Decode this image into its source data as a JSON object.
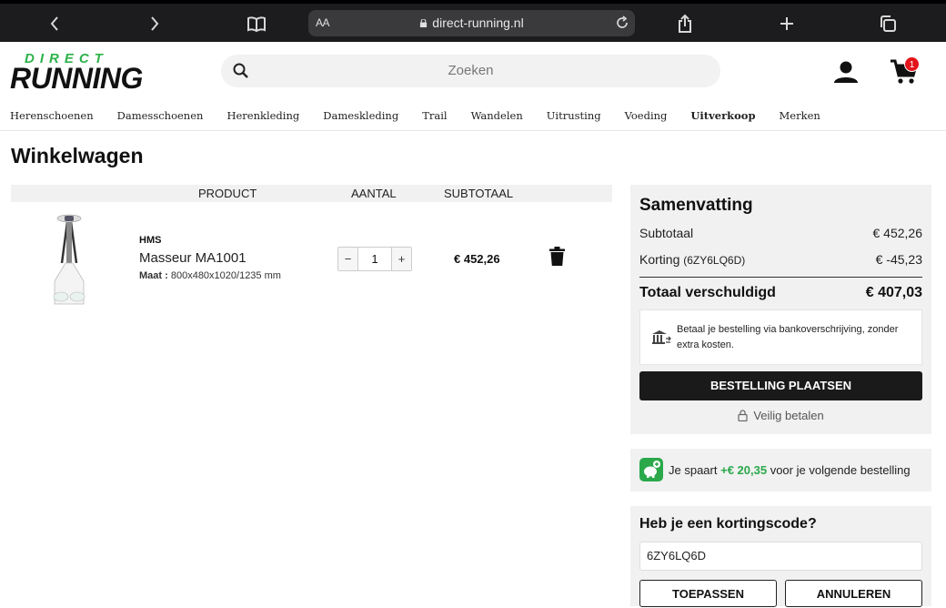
{
  "browser": {
    "aa": "AA",
    "url": "direct-running.nl"
  },
  "logo": {
    "top": "DIRECT",
    "bottom": "RUNNING"
  },
  "search": {
    "placeholder": "Zoeken"
  },
  "cart": {
    "count": "1"
  },
  "nav": [
    "Herenschoenen",
    "Damesschoenen",
    "Herenkleding",
    "Dameskleding",
    "Trail",
    "Wandelen",
    "Uitrusting",
    "Voeding",
    "Uitverkoop",
    "Merken"
  ],
  "page": {
    "title": "Winkelwagen"
  },
  "table": {
    "headers": {
      "product": "PRODUCT",
      "qty": "AANTAL",
      "subtotal": "SUBTOTAAL"
    },
    "item": {
      "brand": "HMS",
      "name": "Masseur MA1001",
      "size_label": "Maat :",
      "size_value": "800x480x1020/1235 mm",
      "qty_minus": "−",
      "qty": "1",
      "qty_plus": "+",
      "total": "€ 452,26"
    }
  },
  "summary": {
    "title": "Samenvatting",
    "subtotal_label": "Subtotaal",
    "subtotal_value": "€ 452,26",
    "discount_label": "Korting",
    "discount_code": "(6ZY6LQ6D)",
    "discount_value": "€ -45,23",
    "total_label": "Totaal verschuldigd",
    "total_value": "€ 407,03",
    "bank_text": "Betaal je bestelling via bankoverschrijving, zonder extra kosten.",
    "order_button": "BESTELLING PLAATSEN",
    "secure": "Veilig betalen"
  },
  "savings": {
    "prefix": "Je spaart",
    "amount": "+€ 20,35",
    "suffix": "voor je volgende bestelling"
  },
  "coupon": {
    "title": "Heb je een kortingscode?",
    "value": "6ZY6LQ6D",
    "apply": "TOEPASSEN",
    "cancel": "ANNULEREN"
  }
}
